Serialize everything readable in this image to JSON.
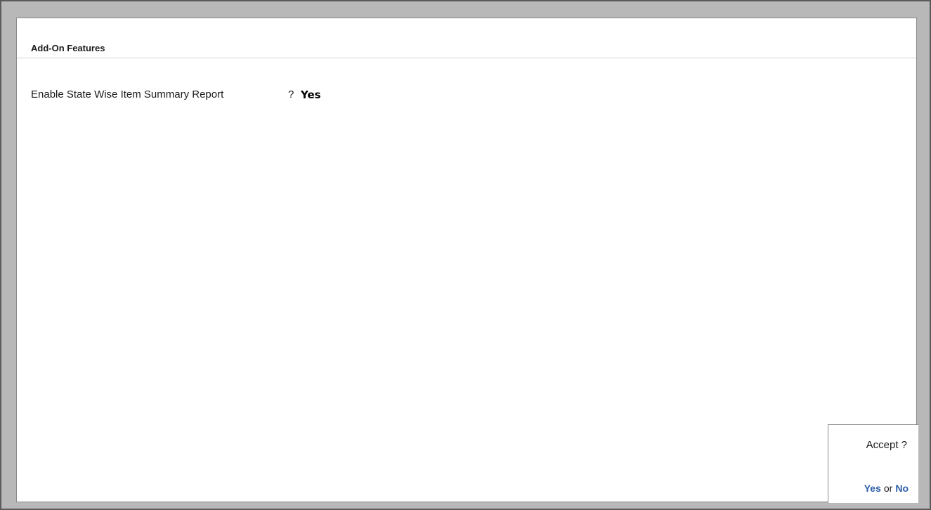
{
  "panel": {
    "title": "Add-On Features"
  },
  "options": [
    {
      "label": "Enable State Wise Item Summary Report",
      "separator": "?",
      "value": "Yes"
    }
  ],
  "accept": {
    "prompt": "Accept ?",
    "yes_label": "Yes",
    "or_label": "or",
    "no_label": "No"
  },
  "colors": {
    "frame_background": "#b8b8b8",
    "panel_background": "#ffffff",
    "choice_accent": "#2b5ea7"
  }
}
